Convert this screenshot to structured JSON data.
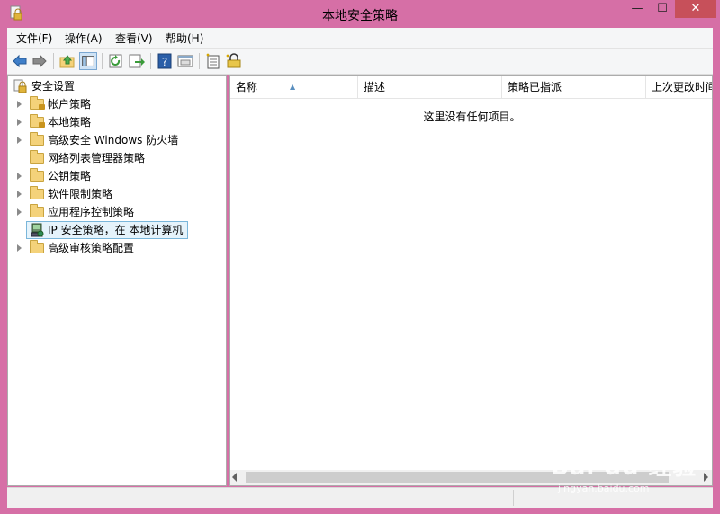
{
  "window": {
    "title": "本地安全策略"
  },
  "menu": [
    "文件(F)",
    "操作(A)",
    "查看(V)",
    "帮助(H)"
  ],
  "tree": {
    "root": "安全设置",
    "items": [
      {
        "label": "帐户策略",
        "expandable": true,
        "icon": "folder-lock-icon"
      },
      {
        "label": "本地策略",
        "expandable": true,
        "icon": "folder-lock-icon"
      },
      {
        "label": "高级安全 Windows 防火墙",
        "expandable": true,
        "icon": "folder-icon"
      },
      {
        "label": "网络列表管理器策略",
        "expandable": false,
        "icon": "folder-icon"
      },
      {
        "label": "公钥策略",
        "expandable": true,
        "icon": "folder-icon"
      },
      {
        "label": "软件限制策略",
        "expandable": true,
        "icon": "folder-icon"
      },
      {
        "label": "应用程序控制策略",
        "expandable": true,
        "icon": "folder-icon"
      },
      {
        "label": "IP 安全策略，在 本地计算机",
        "expandable": false,
        "icon": "ip-security-icon",
        "selected": true
      },
      {
        "label": "高级审核策略配置",
        "expandable": true,
        "icon": "folder-icon"
      }
    ]
  },
  "list": {
    "columns": [
      "名称",
      "描述",
      "策略已指派",
      "上次更改时间"
    ],
    "empty_message": "这里没有任何项目。"
  },
  "watermark": {
    "logo": "Bai du 经验",
    "sub": "jingyan.baidu.com"
  }
}
